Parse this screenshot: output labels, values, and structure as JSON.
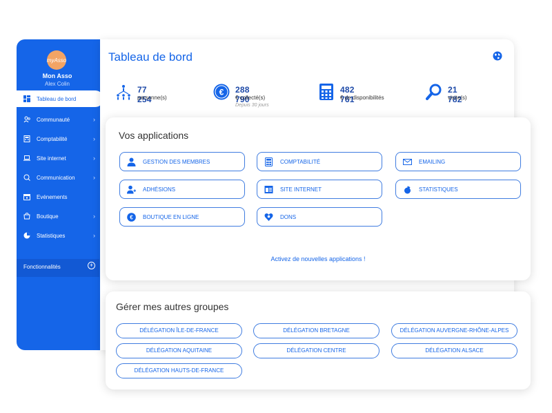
{
  "sidebar": {
    "avatar_text": "myAsso",
    "org_name": "Mon Asso",
    "user_name": "Alex Colin",
    "items": [
      {
        "label": "Tableau de bord"
      },
      {
        "label": "Communauté"
      },
      {
        "label": "Comptabilité"
      },
      {
        "label": "Site internet"
      },
      {
        "label": "Communication"
      },
      {
        "label": "Evénements"
      },
      {
        "label": "Boutique"
      },
      {
        "label": "Statistiques"
      }
    ],
    "features_label": "Fonctionnalités"
  },
  "header": {
    "title": "Tableau de bord"
  },
  "stats": [
    {
      "value": "77 254",
      "label": "personne(s)",
      "icon": "people-icon"
    },
    {
      "value": "288 790",
      "label": "€ collecté(s)",
      "sublabel": "Depuis 30 jours",
      "icon": "euro-icon"
    },
    {
      "value": "482 761",
      "label": "€ de disponibilités",
      "icon": "calculator-icon"
    },
    {
      "value": "21 782",
      "label": "visite(s)",
      "icon": "magnifier-icon"
    }
  ],
  "apps": {
    "title": "Vos applications",
    "items": [
      {
        "label": "GESTION DES MEMBRES",
        "icon": "user-icon"
      },
      {
        "label": "COMPTABILITÉ",
        "icon": "calculator-icon"
      },
      {
        "label": "EMAILING",
        "icon": "envelope-icon"
      },
      {
        "label": "ADHÉSIONS",
        "icon": "user-add-icon"
      },
      {
        "label": "SITE INTERNET",
        "icon": "website-icon"
      },
      {
        "label": "STATISTIQUES",
        "icon": "chart-icon"
      },
      {
        "label": "BOUTIQUE EN LIGNE",
        "icon": "euro-icon"
      },
      {
        "label": "DONS",
        "icon": "heart-icon"
      }
    ],
    "activate_link": "Activez de nouvelles applications !"
  },
  "groups": {
    "title": "Gérer mes autres groupes",
    "items": [
      {
        "label": "DÉLÉGATION ÎLE-DE-FRANCE"
      },
      {
        "label": "DÉLÉGATION BRETAGNE"
      },
      {
        "label": "DÉLÉGATION AUVERGNE-RHÔNE-ALPES"
      },
      {
        "label": "DÉLÉGATION AQUITAINE"
      },
      {
        "label": "DÉLÉGATION CENTRE"
      },
      {
        "label": "DÉLÉGATION ALSACE"
      },
      {
        "label": "DÉLÉGATION HAUTS-DE-FRANCE"
      }
    ]
  },
  "colors": {
    "primary": "#1565e8",
    "avatar": "#f2a465"
  }
}
